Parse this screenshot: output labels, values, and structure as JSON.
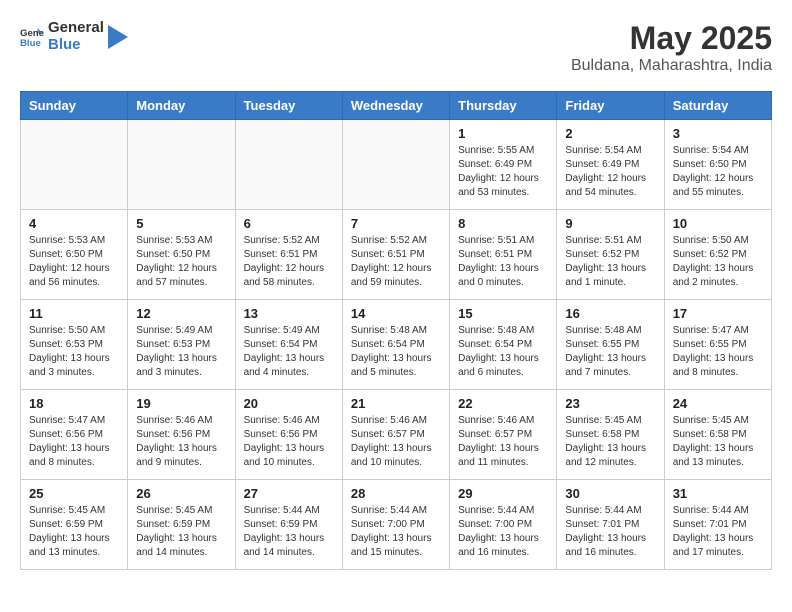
{
  "header": {
    "logo_general": "General",
    "logo_blue": "Blue",
    "month_year": "May 2025",
    "location": "Buldana, Maharashtra, India"
  },
  "weekdays": [
    "Sunday",
    "Monday",
    "Tuesday",
    "Wednesday",
    "Thursday",
    "Friday",
    "Saturday"
  ],
  "weeks": [
    [
      {
        "day": "",
        "info": ""
      },
      {
        "day": "",
        "info": ""
      },
      {
        "day": "",
        "info": ""
      },
      {
        "day": "",
        "info": ""
      },
      {
        "day": "1",
        "info": "Sunrise: 5:55 AM\nSunset: 6:49 PM\nDaylight: 12 hours\nand 53 minutes."
      },
      {
        "day": "2",
        "info": "Sunrise: 5:54 AM\nSunset: 6:49 PM\nDaylight: 12 hours\nand 54 minutes."
      },
      {
        "day": "3",
        "info": "Sunrise: 5:54 AM\nSunset: 6:50 PM\nDaylight: 12 hours\nand 55 minutes."
      }
    ],
    [
      {
        "day": "4",
        "info": "Sunrise: 5:53 AM\nSunset: 6:50 PM\nDaylight: 12 hours\nand 56 minutes."
      },
      {
        "day": "5",
        "info": "Sunrise: 5:53 AM\nSunset: 6:50 PM\nDaylight: 12 hours\nand 57 minutes."
      },
      {
        "day": "6",
        "info": "Sunrise: 5:52 AM\nSunset: 6:51 PM\nDaylight: 12 hours\nand 58 minutes."
      },
      {
        "day": "7",
        "info": "Sunrise: 5:52 AM\nSunset: 6:51 PM\nDaylight: 12 hours\nand 59 minutes."
      },
      {
        "day": "8",
        "info": "Sunrise: 5:51 AM\nSunset: 6:51 PM\nDaylight: 13 hours\nand 0 minutes."
      },
      {
        "day": "9",
        "info": "Sunrise: 5:51 AM\nSunset: 6:52 PM\nDaylight: 13 hours\nand 1 minute."
      },
      {
        "day": "10",
        "info": "Sunrise: 5:50 AM\nSunset: 6:52 PM\nDaylight: 13 hours\nand 2 minutes."
      }
    ],
    [
      {
        "day": "11",
        "info": "Sunrise: 5:50 AM\nSunset: 6:53 PM\nDaylight: 13 hours\nand 3 minutes."
      },
      {
        "day": "12",
        "info": "Sunrise: 5:49 AM\nSunset: 6:53 PM\nDaylight: 13 hours\nand 3 minutes."
      },
      {
        "day": "13",
        "info": "Sunrise: 5:49 AM\nSunset: 6:54 PM\nDaylight: 13 hours\nand 4 minutes."
      },
      {
        "day": "14",
        "info": "Sunrise: 5:48 AM\nSunset: 6:54 PM\nDaylight: 13 hours\nand 5 minutes."
      },
      {
        "day": "15",
        "info": "Sunrise: 5:48 AM\nSunset: 6:54 PM\nDaylight: 13 hours\nand 6 minutes."
      },
      {
        "day": "16",
        "info": "Sunrise: 5:48 AM\nSunset: 6:55 PM\nDaylight: 13 hours\nand 7 minutes."
      },
      {
        "day": "17",
        "info": "Sunrise: 5:47 AM\nSunset: 6:55 PM\nDaylight: 13 hours\nand 8 minutes."
      }
    ],
    [
      {
        "day": "18",
        "info": "Sunrise: 5:47 AM\nSunset: 6:56 PM\nDaylight: 13 hours\nand 8 minutes."
      },
      {
        "day": "19",
        "info": "Sunrise: 5:46 AM\nSunset: 6:56 PM\nDaylight: 13 hours\nand 9 minutes."
      },
      {
        "day": "20",
        "info": "Sunrise: 5:46 AM\nSunset: 6:56 PM\nDaylight: 13 hours\nand 10 minutes."
      },
      {
        "day": "21",
        "info": "Sunrise: 5:46 AM\nSunset: 6:57 PM\nDaylight: 13 hours\nand 10 minutes."
      },
      {
        "day": "22",
        "info": "Sunrise: 5:46 AM\nSunset: 6:57 PM\nDaylight: 13 hours\nand 11 minutes."
      },
      {
        "day": "23",
        "info": "Sunrise: 5:45 AM\nSunset: 6:58 PM\nDaylight: 13 hours\nand 12 minutes."
      },
      {
        "day": "24",
        "info": "Sunrise: 5:45 AM\nSunset: 6:58 PM\nDaylight: 13 hours\nand 13 minutes."
      }
    ],
    [
      {
        "day": "25",
        "info": "Sunrise: 5:45 AM\nSunset: 6:59 PM\nDaylight: 13 hours\nand 13 minutes."
      },
      {
        "day": "26",
        "info": "Sunrise: 5:45 AM\nSunset: 6:59 PM\nDaylight: 13 hours\nand 14 minutes."
      },
      {
        "day": "27",
        "info": "Sunrise: 5:44 AM\nSunset: 6:59 PM\nDaylight: 13 hours\nand 14 minutes."
      },
      {
        "day": "28",
        "info": "Sunrise: 5:44 AM\nSunset: 7:00 PM\nDaylight: 13 hours\nand 15 minutes."
      },
      {
        "day": "29",
        "info": "Sunrise: 5:44 AM\nSunset: 7:00 PM\nDaylight: 13 hours\nand 16 minutes."
      },
      {
        "day": "30",
        "info": "Sunrise: 5:44 AM\nSunset: 7:01 PM\nDaylight: 13 hours\nand 16 minutes."
      },
      {
        "day": "31",
        "info": "Sunrise: 5:44 AM\nSunset: 7:01 PM\nDaylight: 13 hours\nand 17 minutes."
      }
    ]
  ]
}
